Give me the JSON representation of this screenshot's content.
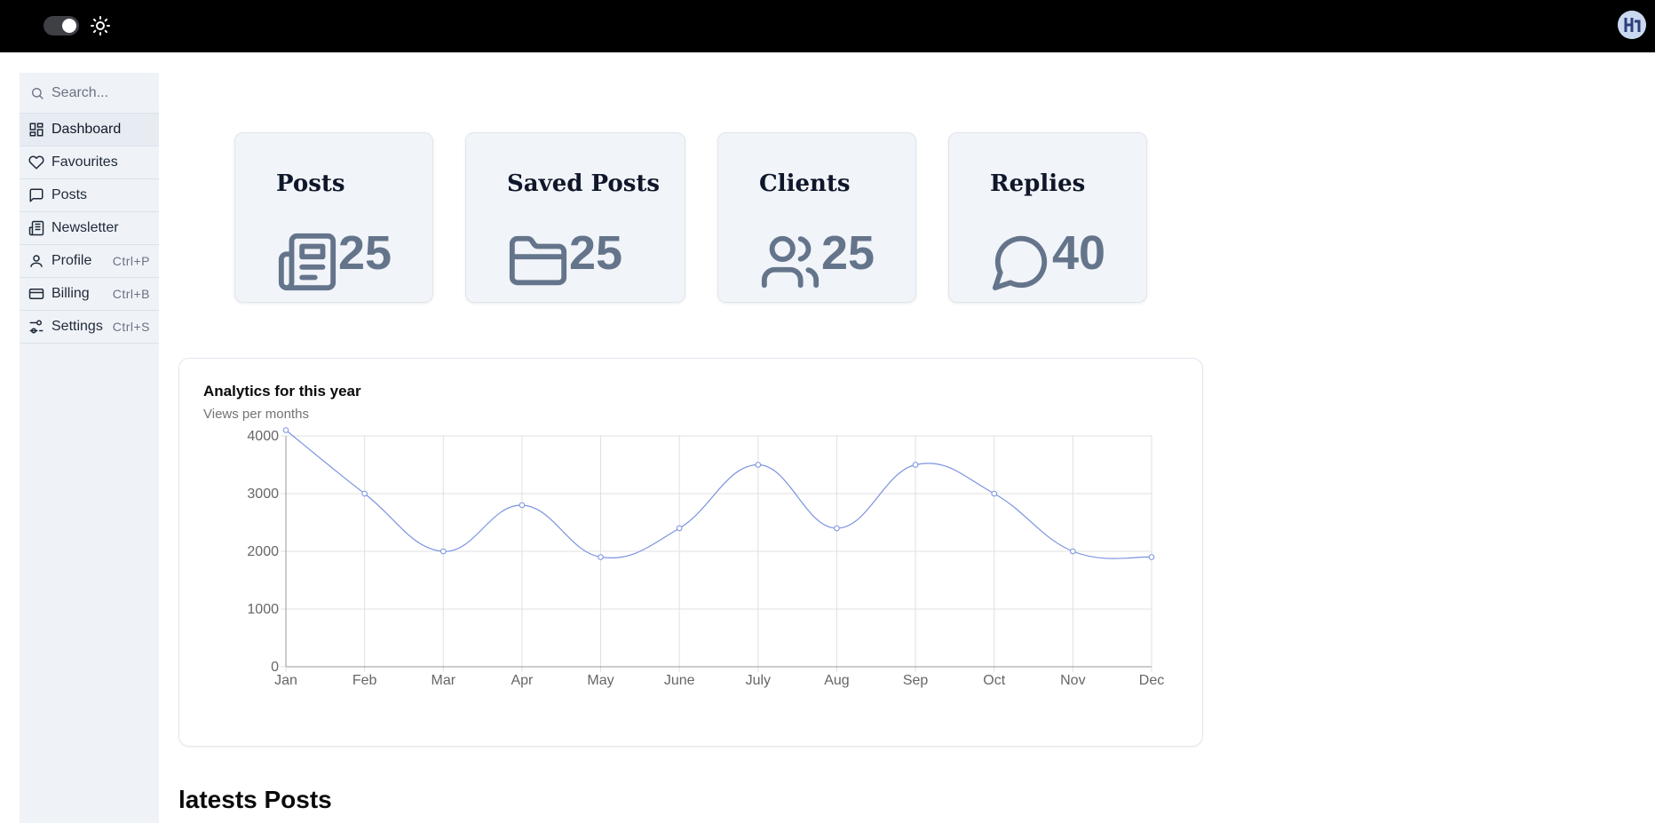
{
  "header": {
    "theme_toggle": "on",
    "icons": {
      "theme": "sun-icon",
      "avatar": "avatar-icon"
    }
  },
  "sidebar": {
    "search_placeholder": "Search...",
    "items": [
      {
        "label": "Dashboard",
        "icon": "dashboard-icon",
        "shortcut": ""
      },
      {
        "label": "Favourites",
        "icon": "heart-icon",
        "shortcut": ""
      },
      {
        "label": "Posts",
        "icon": "message-icon",
        "shortcut": ""
      },
      {
        "label": "Newsletter",
        "icon": "newspaper-icon",
        "shortcut": ""
      },
      {
        "label": "Profile",
        "icon": "user-icon",
        "shortcut": "Ctrl+P"
      },
      {
        "label": "Billing",
        "icon": "credit-card-icon",
        "shortcut": "Ctrl+B"
      },
      {
        "label": "Settings",
        "icon": "settings-icon",
        "shortcut": "Ctrl+S"
      }
    ]
  },
  "stats": [
    {
      "title": "Posts",
      "value": "25",
      "icon": "newspaper-icon"
    },
    {
      "title": "Saved Posts",
      "value": "25",
      "icon": "folder-icon"
    },
    {
      "title": "Clients",
      "value": "25",
      "icon": "users-icon"
    },
    {
      "title": "Replies",
      "value": "40",
      "icon": "message-circle-icon"
    }
  ],
  "analytics": {
    "title": "Analytics for this year",
    "subtitle": "Views per months"
  },
  "chart_data": {
    "type": "line",
    "categories": [
      "Jan",
      "Feb",
      "Mar",
      "Apr",
      "May",
      "June",
      "July",
      "Aug",
      "Sep",
      "Oct",
      "Nov",
      "Dec"
    ],
    "series": [
      {
        "values": [
          4100,
          3000,
          2000,
          2800,
          1900,
          2400,
          3500,
          2400,
          3500,
          3000,
          2000,
          1900
        ]
      }
    ],
    "yticks": [
      0,
      1000,
      2000,
      3000,
      4000
    ],
    "ylim": [
      0,
      4000
    ],
    "grid": true,
    "line_color": "#7b93e0"
  },
  "latest": {
    "title": "latests Posts"
  }
}
